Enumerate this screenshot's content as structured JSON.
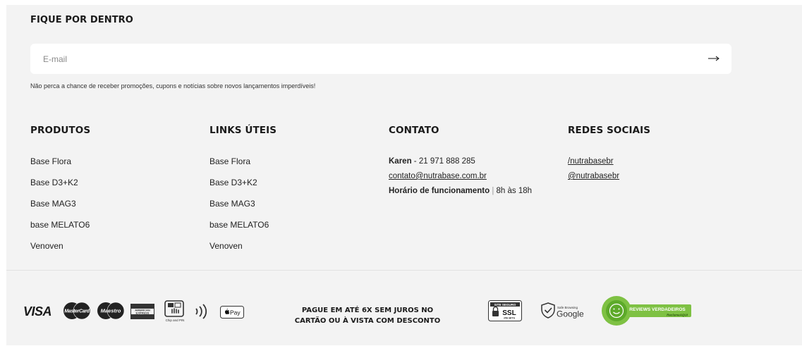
{
  "newsletter": {
    "title": "FIQUE POR DENTRO",
    "placeholder": "E-mail",
    "submit_arrow": "⟶",
    "note": "Não perca a chance de receber promoções, cupons e notícias sobre novos lançamentos imperdíveis!"
  },
  "produtos": {
    "title": "PRODUTOS",
    "items": [
      "Base Flora",
      "Base D3+K2",
      "Base MAG3",
      "base MELATO6",
      "Venoven"
    ]
  },
  "links": {
    "title": "LINKS ÚTEIS",
    "items": [
      "Base Flora",
      "Base D3+K2",
      "Base MAG3",
      "base MELATO6",
      "Venoven"
    ]
  },
  "contato": {
    "title": "CONTATO",
    "name": "Karen",
    "phone": " - 21 971 888 285",
    "email": "contato@nutrabase.com.br",
    "hours_label": "Horário de funcionamento",
    "hours_sep": " | ",
    "hours_value": "8h às 18h"
  },
  "redes": {
    "title": "REDES SOCIAIS",
    "items": [
      "/nutrabasebr",
      "@nutrabasebr"
    ]
  },
  "payment": {
    "visa": "VISA",
    "mastercard": "MasterCard",
    "maestro": "Maestro",
    "amex_line1": "AMERICAN",
    "amex_line2": "EXPRESS",
    "chip_label": "Chip and PIN",
    "applepay": "Pay",
    "text_line1": "PAGUE EM ATÉ 6X SEM JUROS NO",
    "text_line2": "CARTÃO OU À VISTA COM DESCONTO"
  },
  "seals": {
    "ssl_top": "SITE SEGURO",
    "ssl_main": "SSL",
    "ssl_bits": "256 BITS",
    "safe_browsing": "Safe Browsing",
    "google": "Google",
    "reviews": "REVIEWS VERDADEIROS",
    "reclame": "ReclameAQUI"
  }
}
